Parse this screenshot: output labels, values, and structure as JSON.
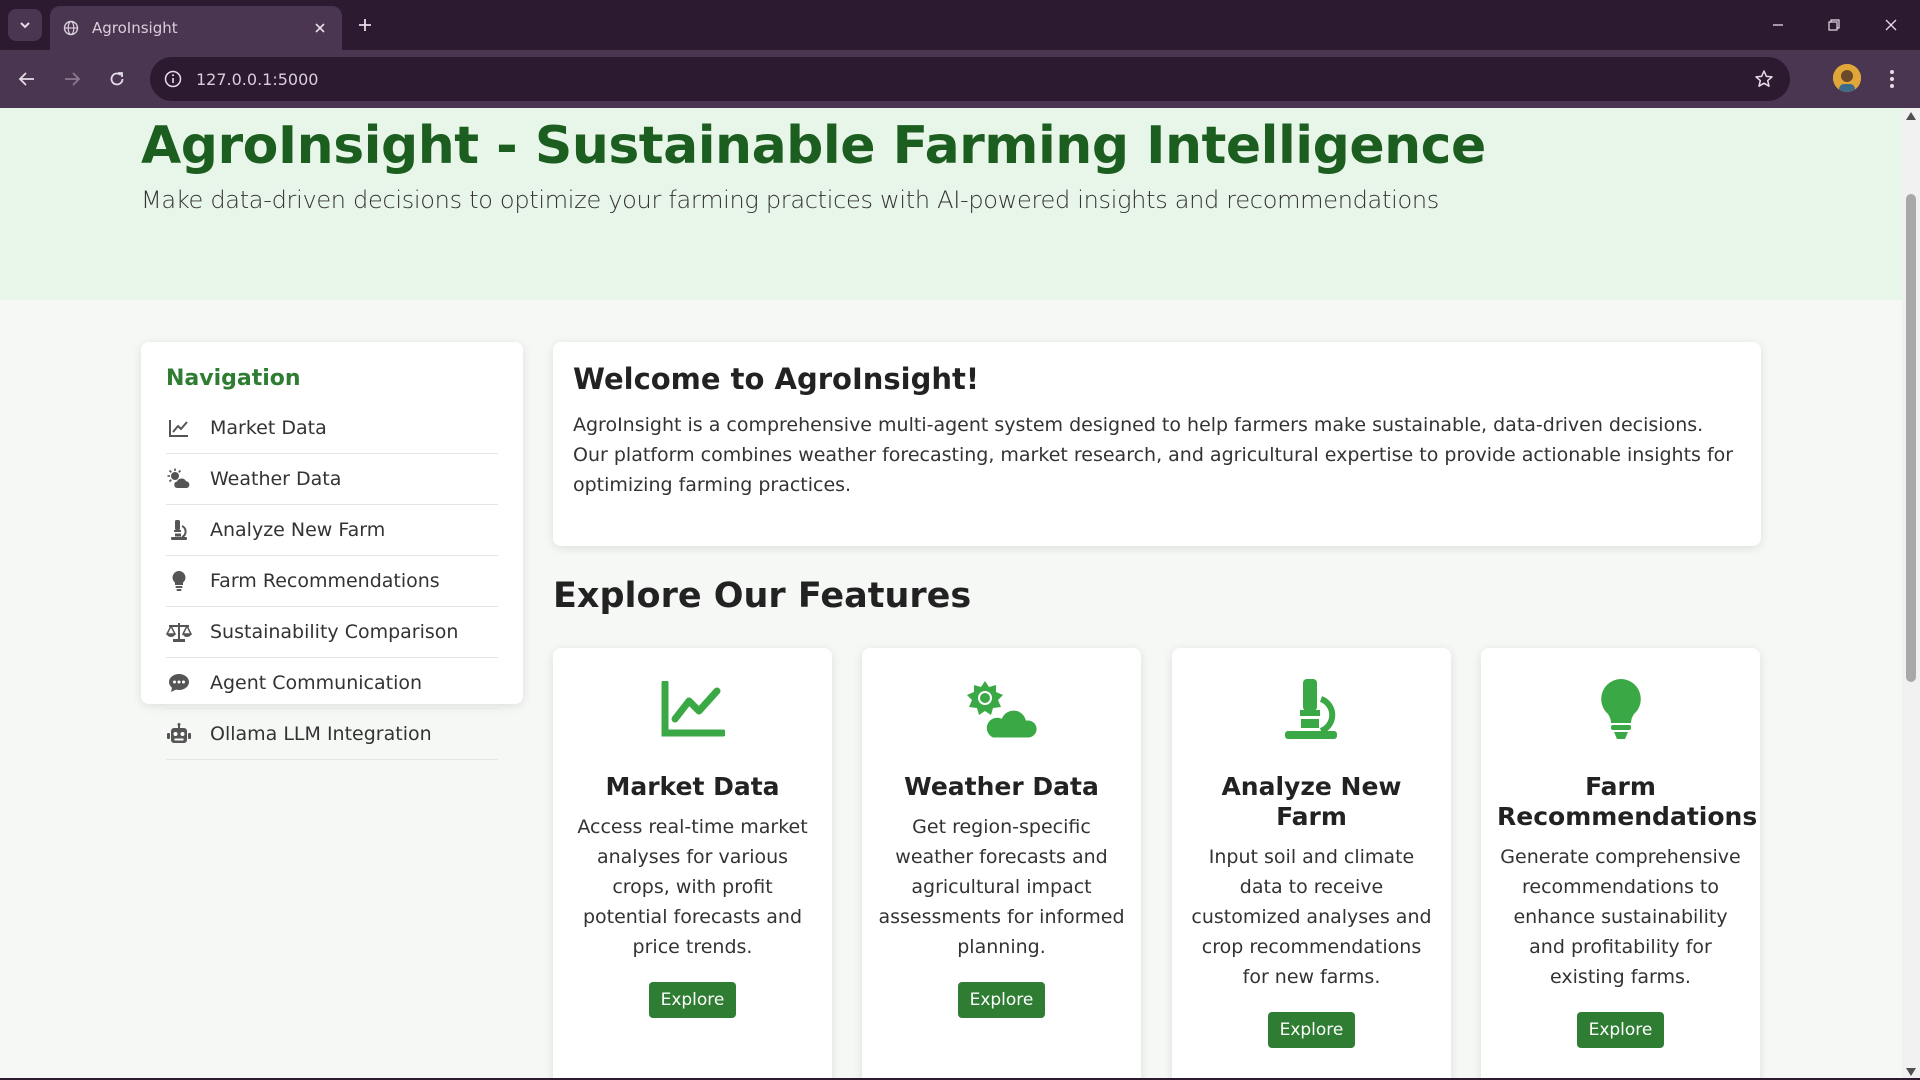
{
  "browser": {
    "tab_title": "AgroInsight",
    "url": "127.0.0.1:5000"
  },
  "hero": {
    "title": "AgroInsight - Sustainable Farming Intelligence",
    "subtitle": "Make data-driven decisions to optimize your farming practices with AI-powered insights and recommendations"
  },
  "navigation": {
    "heading": "Navigation",
    "items": [
      {
        "label": "Market Data",
        "icon": "chart-line-icon"
      },
      {
        "label": "Weather Data",
        "icon": "cloud-sun-icon"
      },
      {
        "label": "Analyze New Farm",
        "icon": "microscope-icon"
      },
      {
        "label": "Farm Recommendations",
        "icon": "lightbulb-icon"
      },
      {
        "label": "Sustainability Comparison",
        "icon": "balance-scale-icon"
      },
      {
        "label": "Agent Communication",
        "icon": "comment-dots-icon"
      },
      {
        "label": "Ollama LLM Integration",
        "icon": "robot-icon"
      }
    ]
  },
  "welcome": {
    "title": "Welcome to AgroInsight!",
    "body": "AgroInsight is a comprehensive multi-agent system designed to help farmers make sustainable, data-driven decisions. Our platform combines weather forecasting, market research, and agricultural expertise to provide actionable insights for optimizing farming practices."
  },
  "features": {
    "heading": "Explore Our Features",
    "cards": [
      {
        "title": "Market Data",
        "description": "Access real-time market analyses for various crops, with profit potential forecasts and price trends.",
        "button": "Explore",
        "icon": "chart-line-icon"
      },
      {
        "title": "Weather Data",
        "description": "Get region-specific weather forecasts and agricultural impact assessments for informed planning.",
        "button": "Explore",
        "icon": "cloud-sun-icon"
      },
      {
        "title": "Analyze New Farm",
        "description": "Input soil and climate data to receive customized analyses and crop recommendations for new farms.",
        "button": "Explore",
        "icon": "microscope-icon"
      },
      {
        "title": "Farm Recommendations",
        "description": "Generate comprehensive recommendations to enhance sustainability and profitability for existing farms.",
        "button": "Explore",
        "icon": "lightbulb-icon"
      }
    ]
  },
  "colors": {
    "brand_dark": "#1b5e20",
    "brand": "#2e7d32",
    "icon_green": "#3aa845",
    "hero_bg": "#e8f5e9"
  }
}
